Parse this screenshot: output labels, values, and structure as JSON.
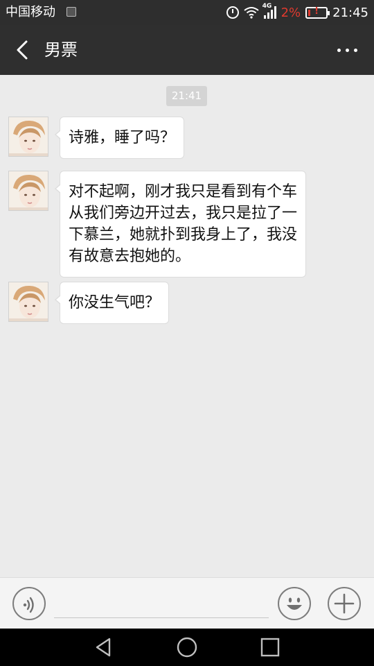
{
  "status_bar": {
    "carrier": "中国移动",
    "network_type": "4G",
    "battery_percent": "2%",
    "time": "21:45"
  },
  "header": {
    "title": "男票"
  },
  "chat": {
    "timestamp": "21:41",
    "messages": [
      {
        "text": "诗雅，睡了吗？"
      },
      {
        "text": "对不起啊，刚才我只是看到有个车\n从我们旁边开过去，我只是拉了一\n下慕兰，她就扑到我身上了，我没\n有故意去抱她的。"
      },
      {
        "text": "你没生气吧？"
      }
    ]
  },
  "input_bar": {
    "placeholder": ""
  },
  "colors": {
    "header_bg": "#2f2f2f",
    "chat_bg": "#ebebeb",
    "battery_low": "#e03a2f"
  }
}
